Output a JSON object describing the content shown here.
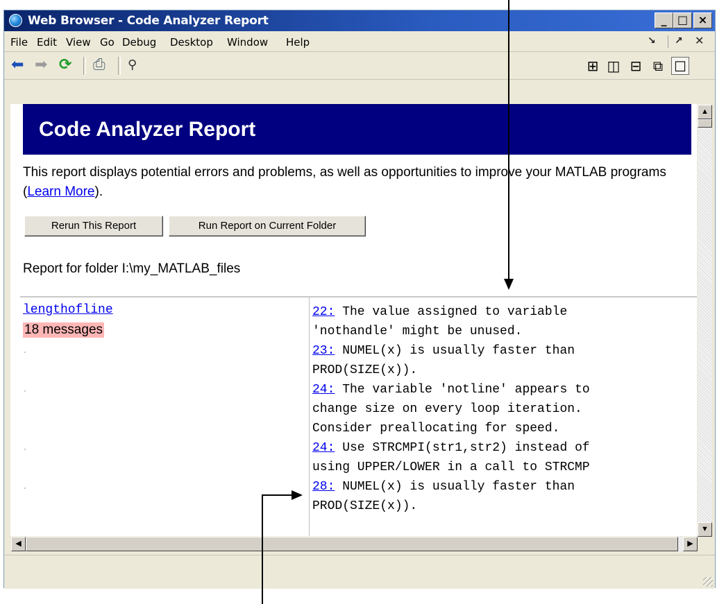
{
  "window": {
    "title": "Web Browser - Code Analyzer Report",
    "controls": {
      "minimize": "_",
      "maximize": "□",
      "close": "×"
    }
  },
  "menu": {
    "items": [
      "File",
      "Edit",
      "View",
      "Go",
      "Debug",
      "Desktop",
      "Window",
      "Help"
    ],
    "right_icons": [
      "undock-icon",
      "dock-icon",
      "close-icon"
    ]
  },
  "toolbar": {
    "icons": [
      "back-arrow-icon",
      "forward-arrow-icon",
      "refresh-icon",
      "print-icon",
      "find-binoculars-icon"
    ],
    "layout_icons": [
      "tile-grid-icon",
      "tile-columns-icon",
      "tile-rows-icon",
      "float-window-icon",
      "maximize-icon"
    ]
  },
  "report": {
    "title": "Code Analyzer Report",
    "intro": "This report displays potential errors and problems, as well as opportunities to improve your MATLAB programs (",
    "learn_more": "Learn More",
    "intro_end": ").",
    "rerun_button": "Rerun This Report",
    "run_folder_button": "Run Report on Current Folder",
    "folder_label": "Report for folder I:\\my_MATLAB_files",
    "file": {
      "name": "lengthofline",
      "count": "18 messages"
    },
    "messages": [
      {
        "line": "22:",
        "text": " The value assigned to variable\n'nothandle' might be unused."
      },
      {
        "line": "23:",
        "text": " NUMEL(x) is usually faster than\nPROD(SIZE(x))."
      },
      {
        "line": "24:",
        "text": " The variable 'notline' appears to\nchange size on every loop iteration.\nConsider preallocating for speed."
      },
      {
        "line": "24:",
        "text": " Use STRCMPI(str1,str2) instead of\nusing UPPER/LOWER in a call to STRCMP"
      },
      {
        "line": "28:",
        "text": " NUMEL(x) is usually faster than\nPROD(SIZE(x))."
      }
    ]
  }
}
